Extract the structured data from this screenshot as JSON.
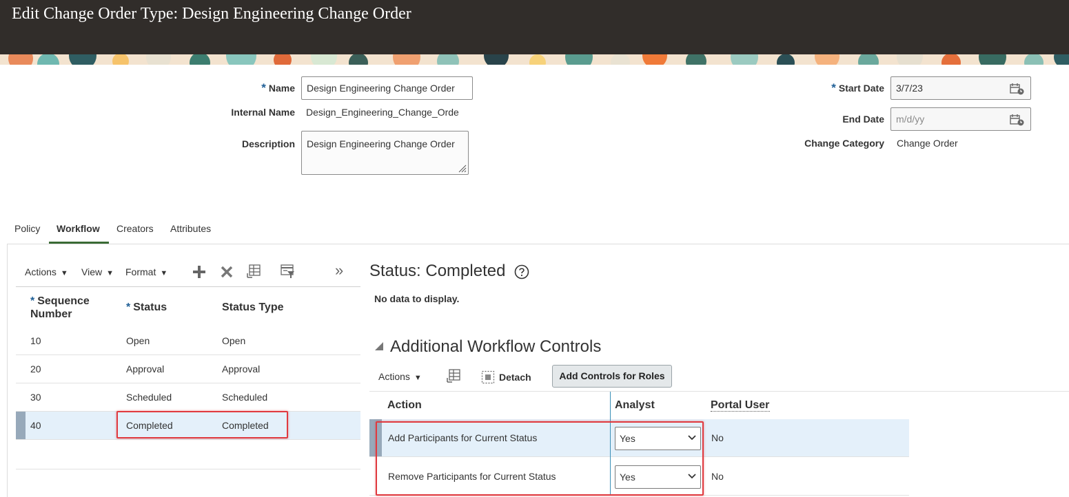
{
  "page": {
    "title": "Edit Change Order Type: Design Engineering Change Order"
  },
  "form": {
    "name": {
      "label": "Name",
      "value": "Design Engineering Change Order"
    },
    "internal_name": {
      "label": "Internal Name",
      "value": "Design_Engineering_Change_Orde"
    },
    "description": {
      "label": "Description",
      "value": "Design Engineering Change Order"
    },
    "start_date": {
      "label": "Start Date",
      "value": "3/7/23"
    },
    "end_date": {
      "label": "End Date",
      "placeholder": "m/d/yy"
    },
    "change_category": {
      "label": "Change Category",
      "value": "Change Order"
    },
    "required_marker": "*"
  },
  "tabs": [
    {
      "label": "Policy",
      "active": false
    },
    {
      "label": "Workflow",
      "active": true
    },
    {
      "label": "Creators",
      "active": false
    },
    {
      "label": "Attributes",
      "active": false
    }
  ],
  "left_toolbar": {
    "actions": "Actions",
    "view": "View",
    "format": "Format",
    "caret": "▼",
    "more": "»"
  },
  "left_table": {
    "columns": {
      "sequence": "Sequence Number",
      "status": "Status",
      "status_type": "Status Type"
    },
    "rows": [
      {
        "sequence": "10",
        "status": "Open",
        "status_type": "Open"
      },
      {
        "sequence": "20",
        "status": "Approval",
        "status_type": "Approval"
      },
      {
        "sequence": "30",
        "status": "Scheduled",
        "status_type": "Scheduled"
      },
      {
        "sequence": "40",
        "status": "Completed",
        "status_type": "Completed"
      }
    ]
  },
  "status_panel": {
    "heading": "Status: Completed",
    "empty_text": "No data to display."
  },
  "workflow_controls": {
    "heading": "Additional Workflow Controls",
    "toolbar": {
      "actions": "Actions",
      "caret": "▼",
      "detach": "Detach",
      "add_controls": "Add Controls for Roles"
    },
    "columns": {
      "action": "Action",
      "analyst": "Analyst",
      "portal_user": "Portal User"
    },
    "rows": [
      {
        "action": "Add Participants for Current Status",
        "analyst": "Yes",
        "portal_user": "No"
      },
      {
        "action": "Remove Participants for Current Status",
        "analyst": "Yes",
        "portal_user": "No"
      }
    ]
  },
  "colors": {
    "header_bg": "#312d2a",
    "tab_underline": "#3a6b35",
    "selected_row": "#e4f0fa",
    "highlight_box": "#e0393e",
    "required_star": "#1f5f96"
  }
}
